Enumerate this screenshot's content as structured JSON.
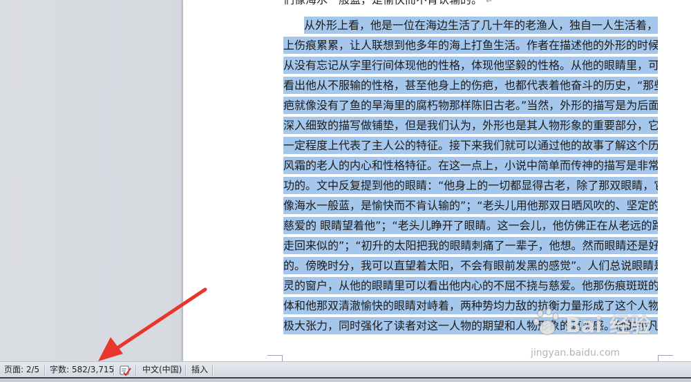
{
  "document": {
    "previous_line": "们像海水一般蓝，是愉快而不肯认输的。",
    "paragraph_end_mark": "↵",
    "lines": [
      "从外形上看，他是一位在海边生活了几十年的老渔人，独自一人生活着，身",
      "上伤痕累累，让人联想到他多年的海上打鱼生活。作者在描述他的外形的时候，",
      "从没有忘记从字里行间体现他的性格，体现他坚毅的性格。从他的眼睛里，可以",
      "看出他从不服输的性格，甚至他身上的伤疤，也都代表着他奋斗的历史，“那些伤",
      "疤就像没有了鱼的旱海里的腐朽物那样陈旧古老。”当然，外形的描写是为后面更",
      "深入细致的描写做铺垫，但是我们认为，外形也是其人物形象的重要部分，它在",
      "一定程度上代表了主人公的特征。接下来我们就可以通过他的故事了解这个历经",
      "风霜的老人的内心和性格特征。在这一点上，小说中简单而传神的描写是非常成",
      "功的。文中反复提到他的眼睛：“他身上的一切都显得古老，除了那双眼睛，它们",
      "像海水一般蓝，是愉快而不肯认输的”；“老头儿用他那双日晒风吹的、坚定的、",
      "慈爱的 眼睛望着他”；“老头儿睁开了眼睛。这一会儿，他仿佛正在从老远的路上",
      "走回来似的”；“初升的太阳把我的眼睛刺痛了一辈子，他想。然而眼睛还是好好",
      "的。傍晚时分，我可以直望着太阳，不会有眼前发黑的感觉”。人们总说眼睛是心",
      "灵的窗户，从他的眼睛里可以看出他内心的不屈不挠与慈爱。他那伤痕斑斑的肉",
      "体和他那双清澈愉快的眼睛对峙着，两种势均力敌的抗衡力量形成了这个人物的",
      "极大张力，同时强化了读者对这一人物的期望和人物形象的真实感。他的平凡和伟"
    ]
  },
  "statusbar": {
    "page_label": "页面: 2/5",
    "word_count_label": "字数: 582/3,715",
    "language_label": "中文(中国)",
    "insert_mode_label": "插入"
  },
  "watermark": {
    "brand": "Bai 经验",
    "url": "jingyan.baidu.com"
  },
  "colors": {
    "selection": "#a6c7ec",
    "arrow": "#e8352e",
    "statusbar": "#dde2e8"
  },
  "icons": {
    "proofing": "spellcheck-icon",
    "arrow": "red-pointer-arrow"
  }
}
